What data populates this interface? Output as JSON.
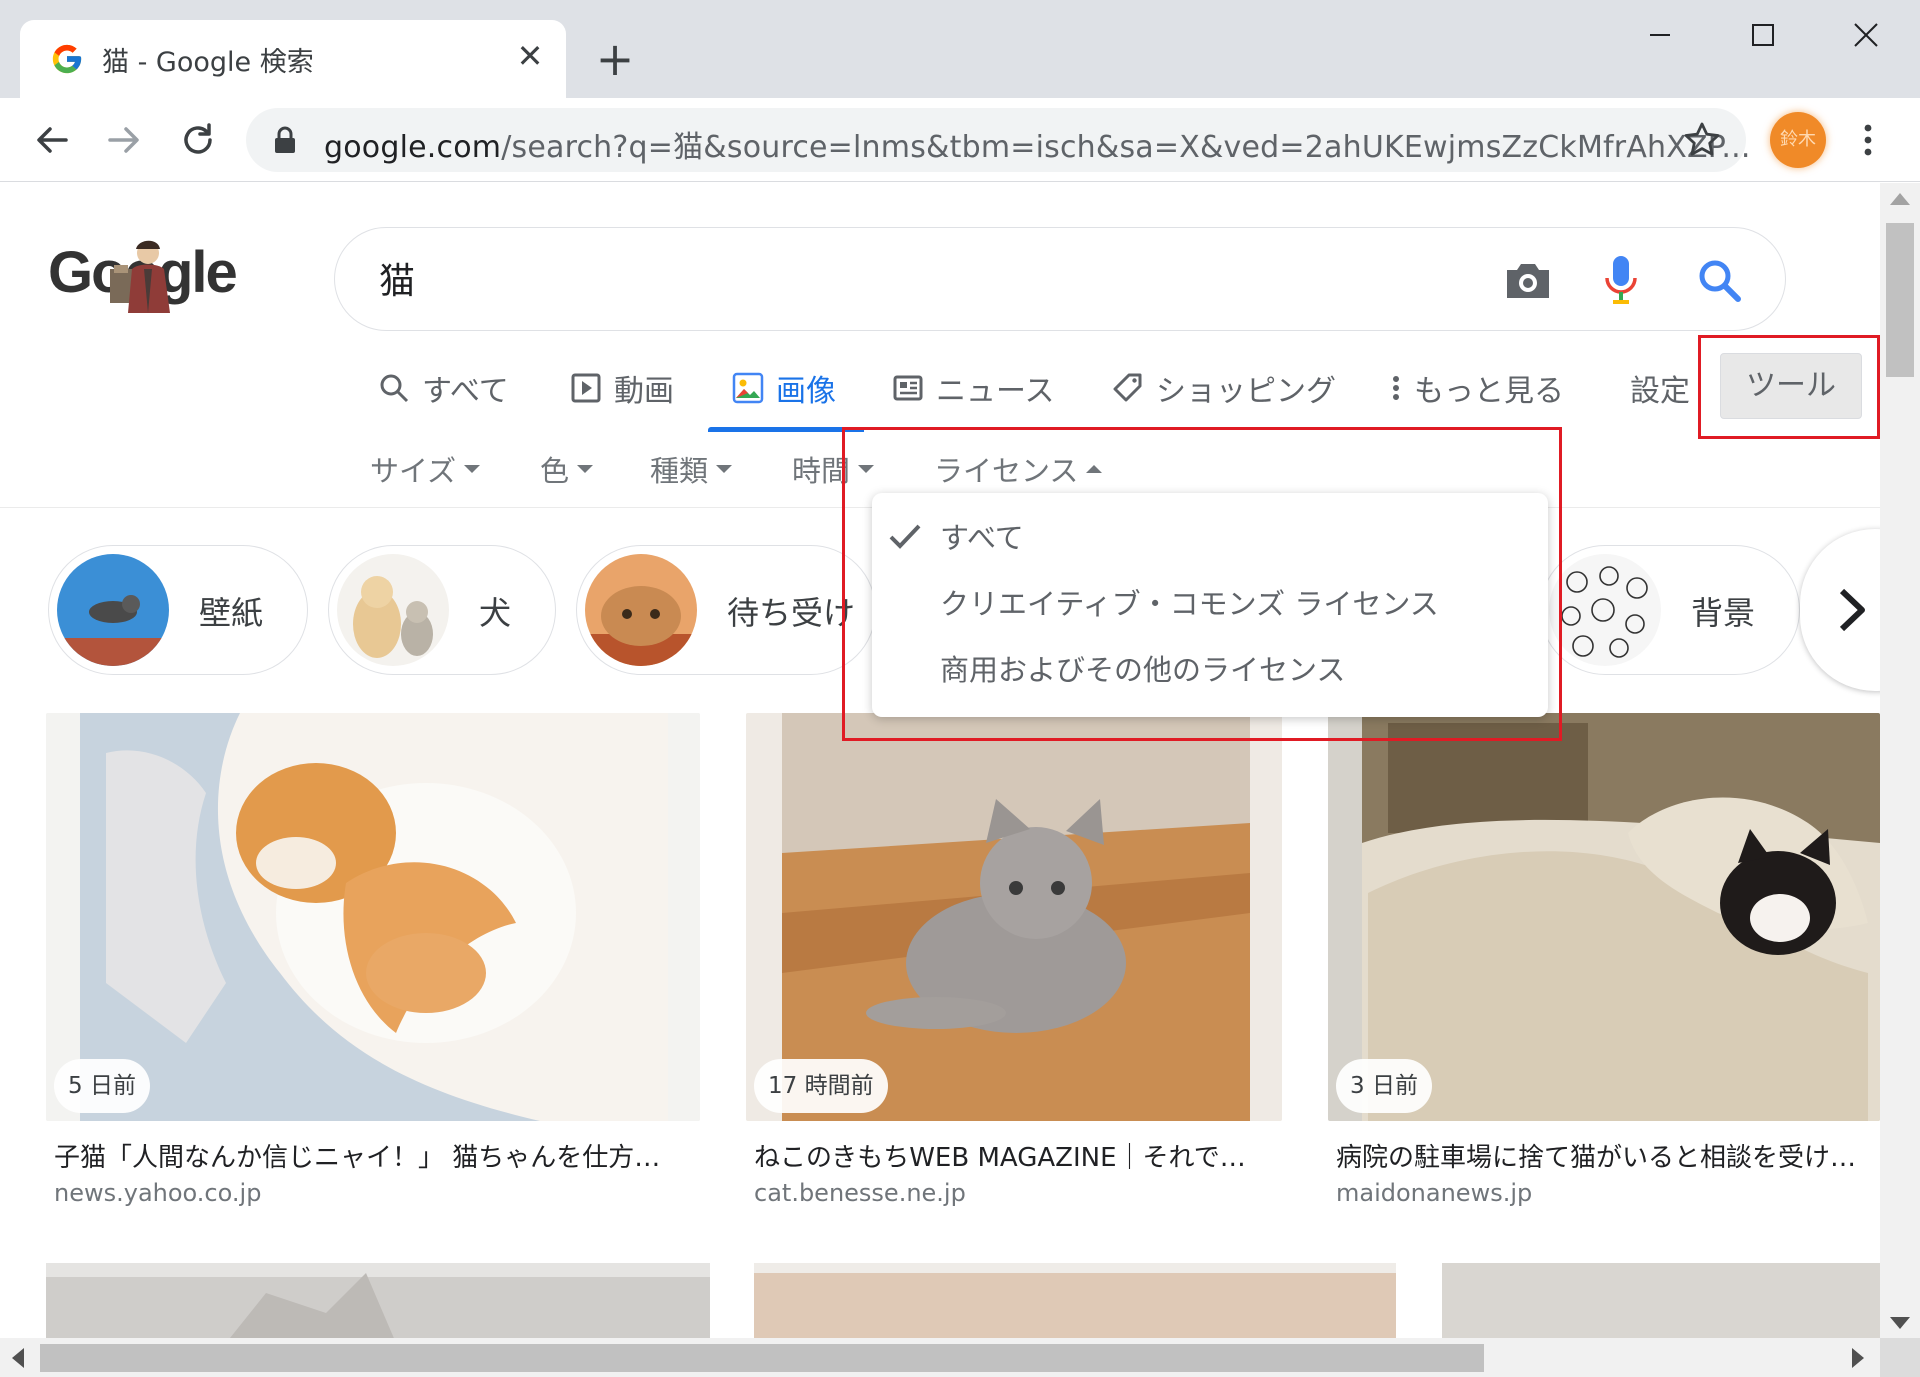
{
  "browser": {
    "tab_title": "猫 - Google 検索",
    "close_glyph": "✕",
    "new_tab_glyph": "+",
    "url_host": "google.com",
    "url_rest": "/search?q=猫&source=lnms&tbm=isch&sa=X&ved=2ahUKEwjmsZzCkMfrAhXZP...",
    "profile_initials": "鈴木"
  },
  "search": {
    "logo_text": "Google",
    "query": "猫"
  },
  "nav_tabs": [
    {
      "label": "すべて",
      "icon": "search-icon"
    },
    {
      "label": "動画",
      "icon": "video-play-icon"
    },
    {
      "label": "画像",
      "icon": "image-icon",
      "active": true
    },
    {
      "label": "ニュース",
      "icon": "news-icon"
    },
    {
      "label": "ショッピング",
      "icon": "tag-icon"
    },
    {
      "label": "もっと見る",
      "icon": "more-vert-icon"
    }
  ],
  "settings_label": "設定",
  "tools_label": "ツール",
  "filters": [
    "サイズ",
    "色",
    "種類",
    "時間",
    "ライセンス"
  ],
  "license_menu": {
    "items": [
      "すべて",
      "クリエイティブ・コモンズ ライセンス",
      "商用およびその他のライセンス"
    ],
    "selected_index": 0
  },
  "chips": [
    "壁紙",
    "犬",
    "待ち受け",
    "背景"
  ],
  "results": [
    {
      "badge": "5 日前",
      "title": "子猫「人間なんか信じニャイ！」 猫ちゃんを仕方…",
      "site": "news.yahoo.co.jp"
    },
    {
      "badge": "17 時間前",
      "title": "ねこのきもちWEB MAGAZINE｜それで…",
      "site": "cat.benesse.ne.jp"
    },
    {
      "badge": "3 日前",
      "title": "病院の駐車場に捨て猫がいると相談を受け…",
      "site": "maidonanews.jp"
    }
  ],
  "colors": {
    "accent": "#1a73e8",
    "highlight_box": "#e01b24",
    "tab_strip": "#dee1e6"
  }
}
